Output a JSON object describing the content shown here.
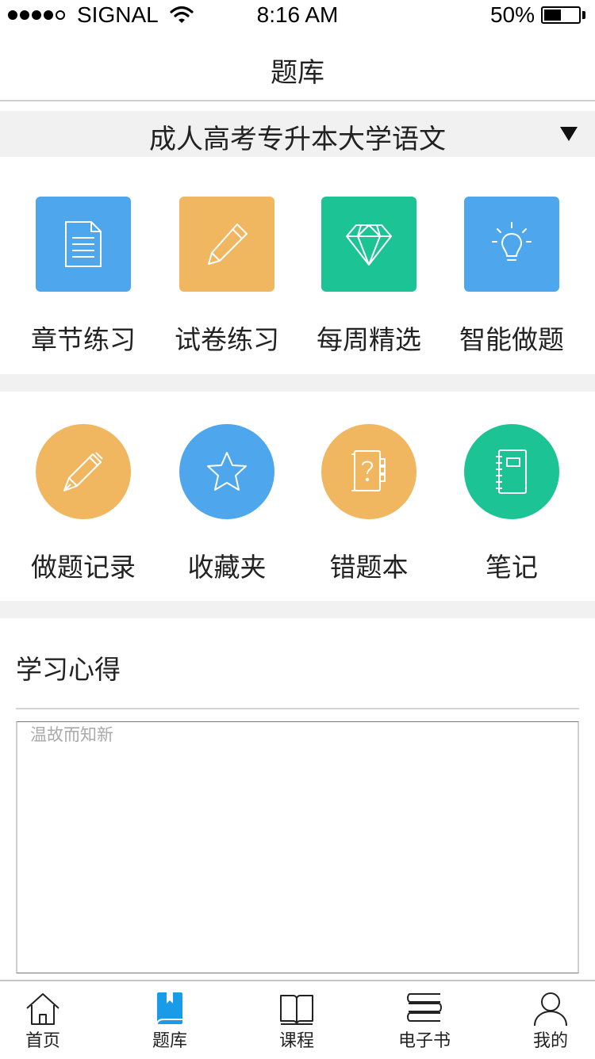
{
  "status": {
    "carrier": "SIGNAL",
    "time": "8:16 AM",
    "battery": "50%",
    "battery_level": 0.5
  },
  "nav": {
    "title": "题库"
  },
  "subject": {
    "selected": "成人高考专升本大学语文"
  },
  "practice": [
    {
      "label": "章节练习",
      "icon": "document-icon",
      "color": "#4ea7ec"
    },
    {
      "label": "试卷练习",
      "icon": "pencil-icon",
      "color": "#f0b660"
    },
    {
      "label": "每周精选",
      "icon": "diamond-icon",
      "color": "#1cc495"
    },
    {
      "label": "智能做题",
      "icon": "lightbulb-icon",
      "color": "#4ea7ec"
    }
  ],
  "tools": [
    {
      "label": "做题记录",
      "icon": "pen-icon",
      "color": "#f0b660"
    },
    {
      "label": "收藏夹",
      "icon": "star-icon",
      "color": "#4ea7ec"
    },
    {
      "label": "错题本",
      "icon": "question-book-icon",
      "color": "#f0b660"
    },
    {
      "label": "笔记",
      "icon": "notebook-icon",
      "color": "#1cc495"
    }
  ],
  "notes": {
    "title": "学习心得",
    "placeholder": "温故而知新"
  },
  "tabs": [
    {
      "label": "首页",
      "icon": "home-icon"
    },
    {
      "label": "题库",
      "icon": "question-bank-icon",
      "active": true,
      "accent": "#1a9be8"
    },
    {
      "label": "课程",
      "icon": "open-book-icon"
    },
    {
      "label": "电子书",
      "icon": "books-stack-icon"
    },
    {
      "label": "我的",
      "icon": "person-icon"
    }
  ]
}
